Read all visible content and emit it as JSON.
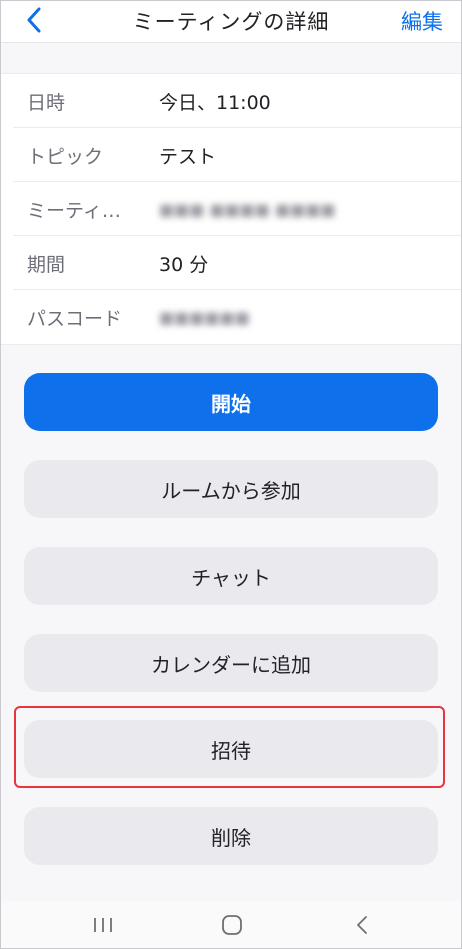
{
  "header": {
    "title": "ミーティングの詳細",
    "edit_label": "編集"
  },
  "details": [
    {
      "label": "日時",
      "value": "今日、11:00"
    },
    {
      "label": "トピック",
      "value": "テスト"
    },
    {
      "label": "ミーティ…",
      "value": "■■■ ■■■■ ■■■■"
    },
    {
      "label": "期間",
      "value": "30 分"
    },
    {
      "label": "パスコード",
      "value": "■■■■■■"
    }
  ],
  "actions": {
    "start": "開始",
    "join_from_room": "ルームから参加",
    "chat": "チャット",
    "add_to_calendar": "カレンダーに追加",
    "invite": "招待",
    "delete": "削除"
  },
  "colors": {
    "accent": "#0e71eb",
    "highlight": "#e8343c"
  },
  "icons": {
    "back": "chevron-left-icon",
    "nav_recent": "recent-apps-icon",
    "nav_home": "home-icon",
    "nav_back": "nav-back-icon"
  }
}
